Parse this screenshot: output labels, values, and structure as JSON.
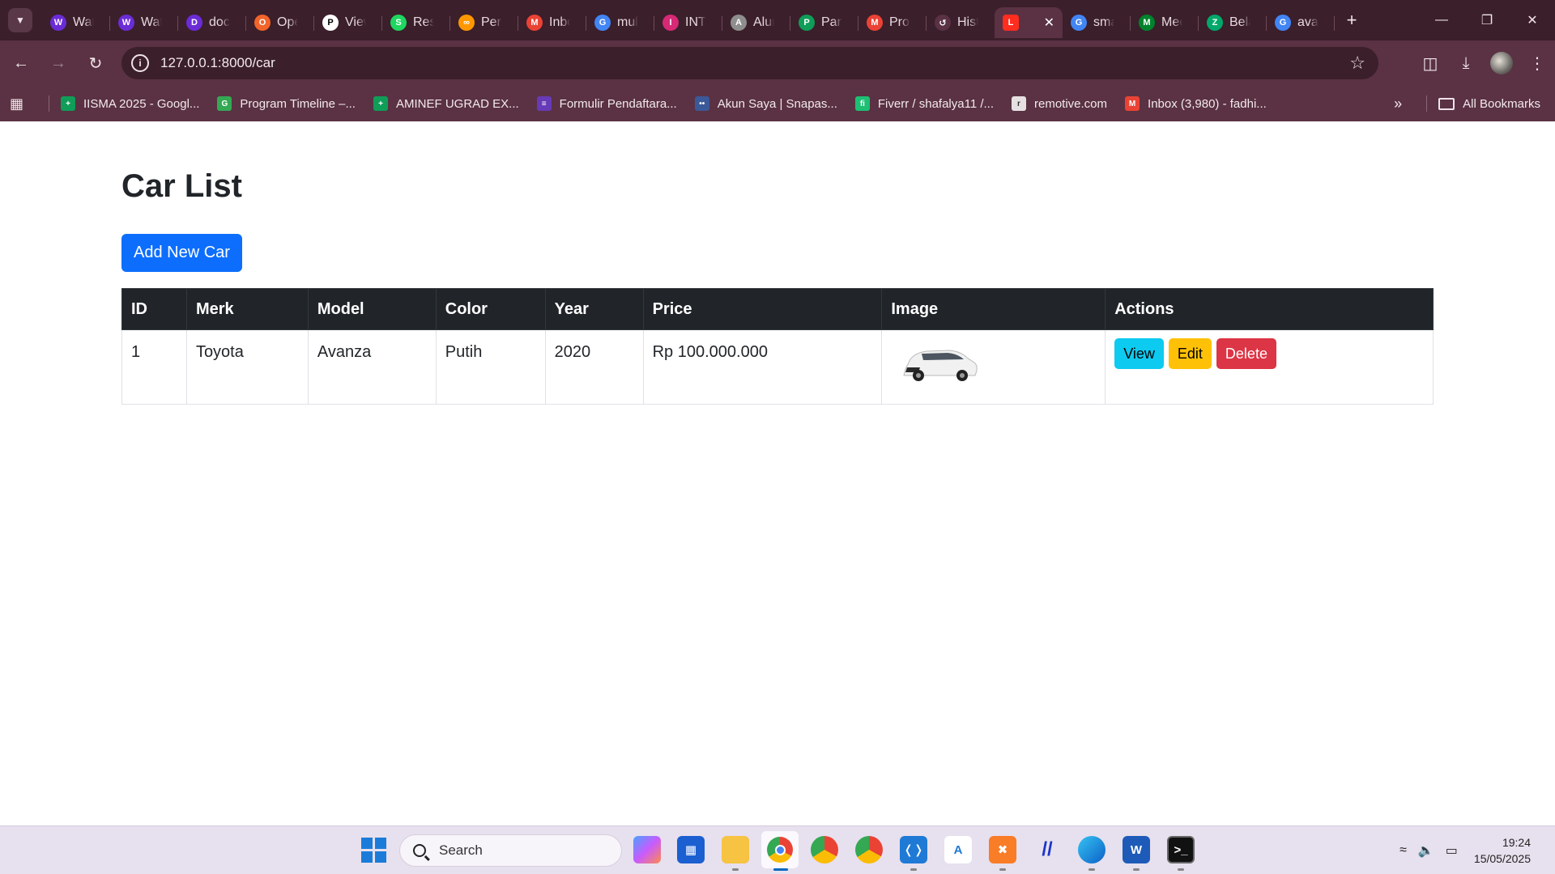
{
  "browser": {
    "tabs": [
      {
        "label": "Wat",
        "icon": "W",
        "color": "#6b2cd6"
      },
      {
        "label": "Wat",
        "icon": "W",
        "color": "#6b2cd6"
      },
      {
        "label": "doc",
        "icon": "D",
        "color": "#6b2cd6"
      },
      {
        "label": "Ope",
        "icon": "O",
        "color": "#f2642a"
      },
      {
        "label": "View",
        "icon": "P",
        "color": "#ffffff"
      },
      {
        "label": "Resi",
        "icon": "S",
        "color": "#1ed760"
      },
      {
        "label": "Perc",
        "icon": "∞",
        "color": "#ff9800"
      },
      {
        "label": "Inbo",
        "icon": "M",
        "color": "#ea4335"
      },
      {
        "label": "mul",
        "icon": "G",
        "color": "#4285f4"
      },
      {
        "label": "INT",
        "icon": "I",
        "color": "#d62976"
      },
      {
        "label": "Alur",
        "icon": "A",
        "color": "#8e8e8e"
      },
      {
        "label": "Para",
        "icon": "P",
        "color": "#0f9d58"
      },
      {
        "label": "Proj",
        "icon": "M",
        "color": "#ea4335"
      },
      {
        "label": "Hist",
        "icon": "↺",
        "color": "#5a3243"
      },
      {
        "label": "",
        "icon": "L",
        "color": "#ff2d20",
        "active": true
      },
      {
        "label": "sma",
        "icon": "G",
        "color": "#4285f4"
      },
      {
        "label": "Mee",
        "icon": "M",
        "color": "#00832d"
      },
      {
        "label": "Bela",
        "icon": "Z",
        "color": "#00a86b"
      },
      {
        "label": "ava",
        "icon": "G",
        "color": "#4285f4"
      }
    ],
    "url": "127.0.0.1:8000/car",
    "bookmarks": [
      {
        "label": "IISMA 2025 - Googl...",
        "icon": "+",
        "color": "#0f9d58"
      },
      {
        "label": "Program Timeline –...",
        "icon": "G",
        "color": "#34a853"
      },
      {
        "label": "AMINEF UGRAD EX...",
        "icon": "+",
        "color": "#0f9d58"
      },
      {
        "label": "Formulir Pendaftara...",
        "icon": "≡",
        "color": "#673ab7"
      },
      {
        "label": "Akun Saya | Snapas...",
        "icon": "••",
        "color": "#3b5998"
      },
      {
        "label": "Fiverr / shafalya11 /...",
        "icon": "fi",
        "color": "#1dbf73"
      },
      {
        "label": "remotive.com",
        "icon": "r",
        "color": "#e7e0e3"
      },
      {
        "label": "Inbox (3,980) - fadhi...",
        "icon": "M",
        "color": "#ea4335"
      }
    ],
    "all_bookmarks_label": "All Bookmarks"
  },
  "page": {
    "title": "Car List",
    "add_button": "Add New Car",
    "columns": [
      "ID",
      "Merk",
      "Model",
      "Color",
      "Year",
      "Price",
      "Image",
      "Actions"
    ],
    "rows": [
      {
        "id": "1",
        "merk": "Toyota",
        "model": "Avanza",
        "color": "Putih",
        "year": "2020",
        "price": "Rp 100.000.000"
      }
    ],
    "actions": {
      "view": "View",
      "edit": "Edit",
      "delete": "Delete"
    },
    "colors": {
      "primary": "#0d6efd",
      "info": "#0dcaf0",
      "warning": "#ffc107",
      "danger": "#dc3545",
      "header": "#212529"
    }
  },
  "taskbar": {
    "search_label": "Search",
    "time": "19:24",
    "date": "15/05/2025"
  }
}
